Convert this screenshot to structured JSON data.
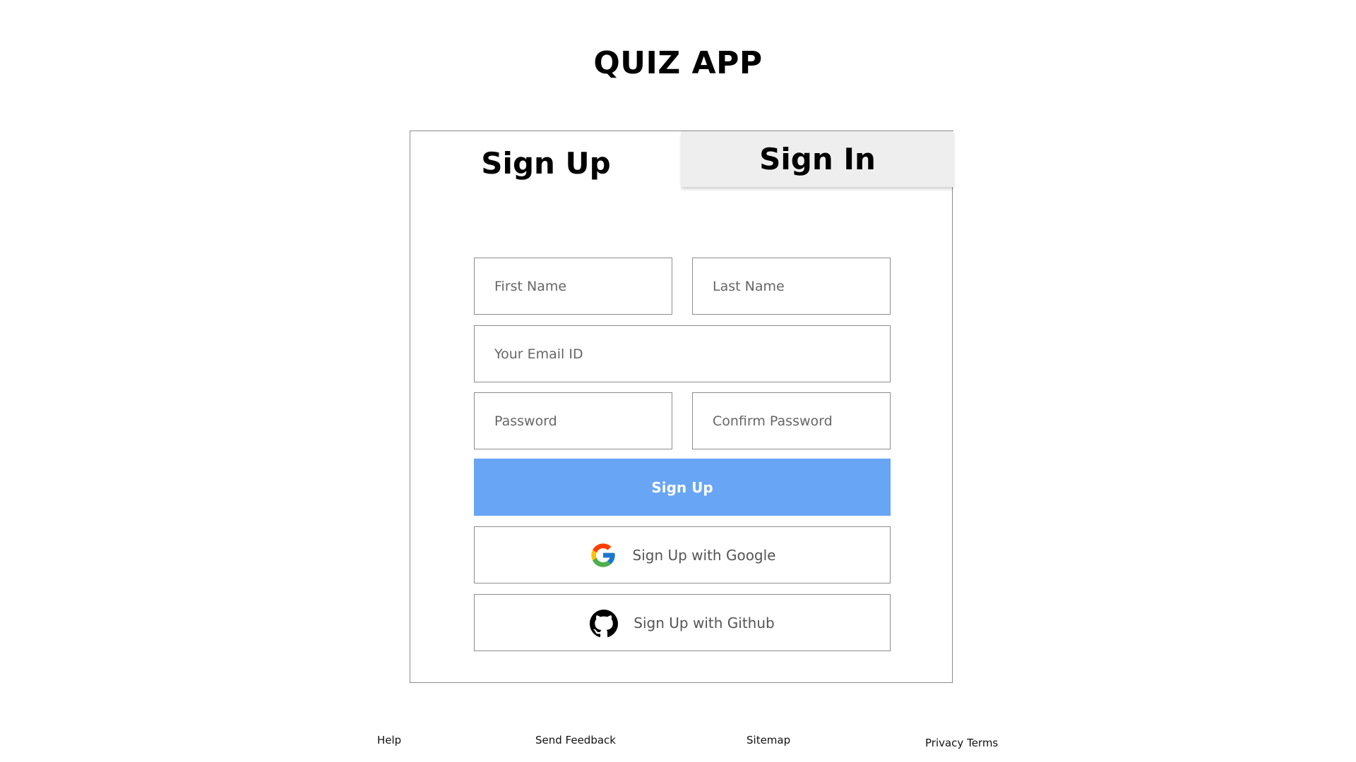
{
  "app": {
    "title": "QUIZ APP"
  },
  "tabs": {
    "signup": "Sign Up",
    "signin": "Sign In"
  },
  "form": {
    "first_name_placeholder": "First Name",
    "last_name_placeholder": "Last Name",
    "email_placeholder": "Your Email ID",
    "password_placeholder": "Password",
    "confirm_password_placeholder": "Confirm Password",
    "submit_label": "Sign Up",
    "google_label": "Sign Up with Google",
    "github_label": "Sign Up with Github"
  },
  "footer": {
    "help": "Help",
    "feedback": "Send Feedback",
    "sitemap": "Sitemap",
    "privacy": "Privacy Terms"
  },
  "colors": {
    "primary_button": "#68a5f5",
    "inactive_tab": "#eeeeee"
  },
  "icons": {
    "google": "google-icon",
    "github": "github-icon"
  }
}
